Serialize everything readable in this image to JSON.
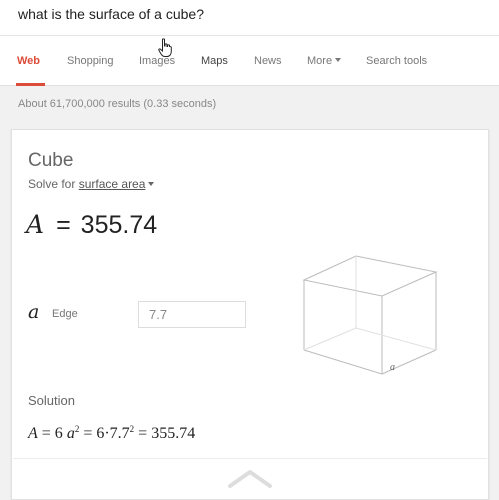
{
  "search": {
    "query": "what is the surface of a cube?"
  },
  "tabs": [
    {
      "label": "Web",
      "active": true
    },
    {
      "label": "Shopping"
    },
    {
      "label": "Images"
    },
    {
      "label": "Maps"
    },
    {
      "label": "News"
    },
    {
      "label": "More"
    },
    {
      "label": "Search tools"
    }
  ],
  "results": {
    "count_text": "About 61,700,000 results (0.33 seconds)"
  },
  "calculator": {
    "title": "Cube",
    "solve_for_prefix": "Solve for",
    "solve_for_value": "surface area",
    "result_var": "A",
    "equals": "=",
    "result_value": "355.74",
    "edge_var": "a",
    "edge_label": "Edge",
    "edge_value": "7.7",
    "diagram_label": "a",
    "solution_label": "Solution",
    "formula": {
      "lhs": "A",
      "eq1": " = 6 ",
      "var": "a",
      "exp1": "2",
      "eq2": " = 6·7.7",
      "exp2": "2",
      "eq3": " = 355.74"
    }
  },
  "colors": {
    "accent": "#dd4b39",
    "text_muted": "#777777",
    "diagram_stroke": "#bbbbbb"
  },
  "icons": {
    "cursor": "hand-cursor-icon",
    "dropdown": "caret-down-icon",
    "expand": "chevron-up-icon"
  }
}
